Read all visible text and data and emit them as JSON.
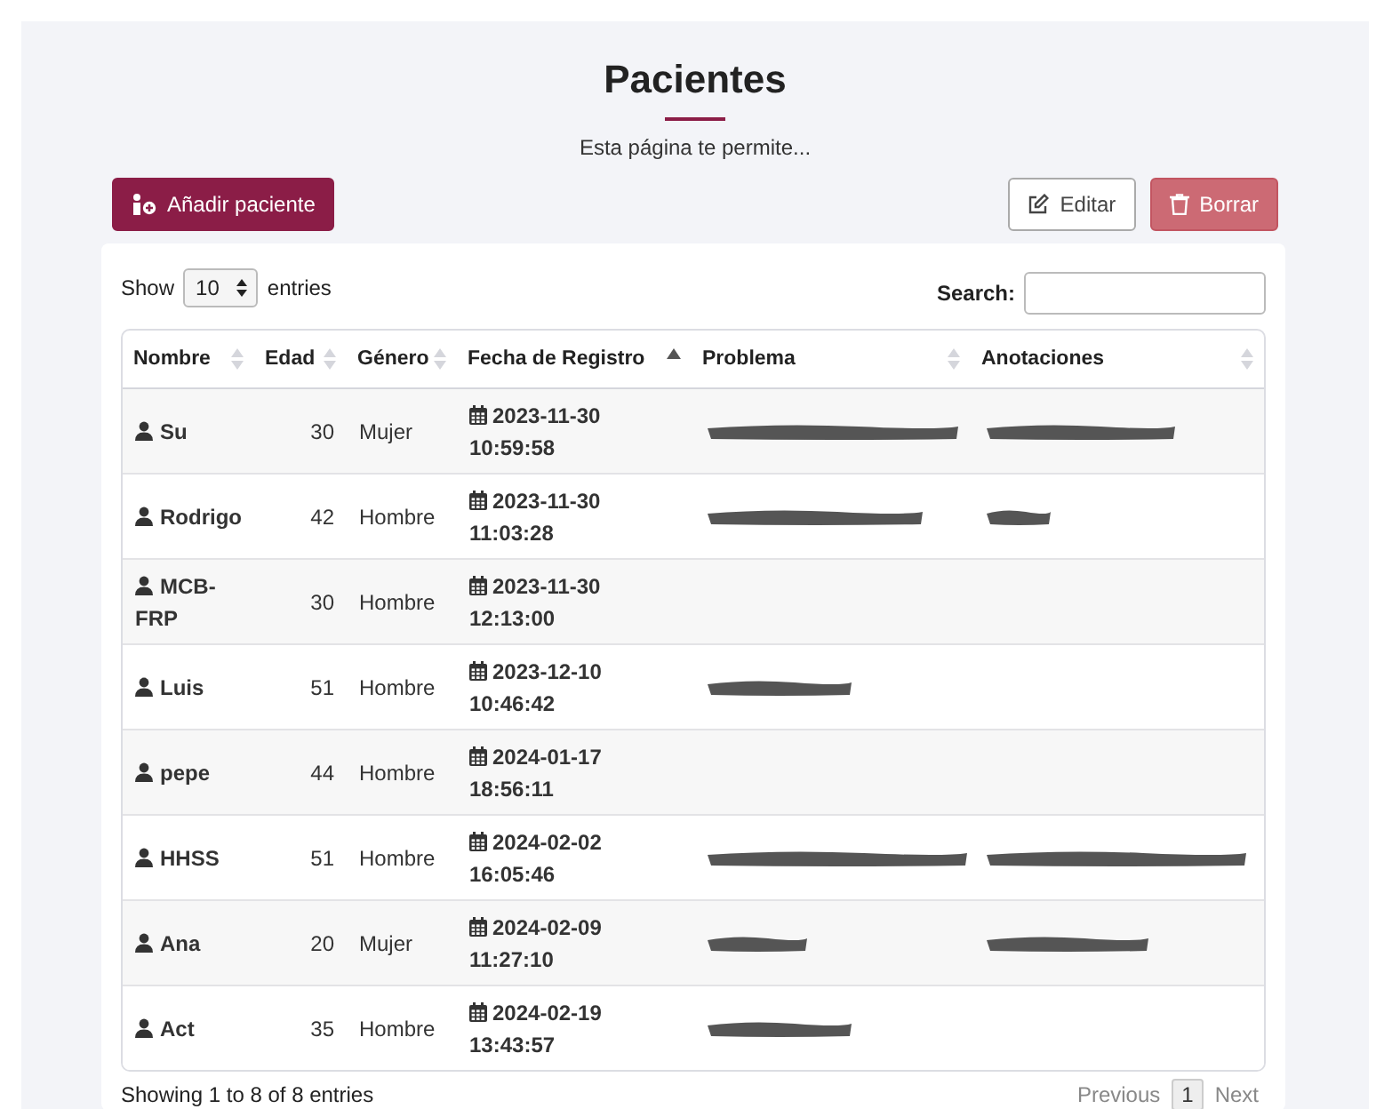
{
  "title": "Pacientes",
  "subtitle": "Esta página te permite...",
  "actions": [
    {
      "kind": "add",
      "label": "Añadir paciente"
    },
    {
      "kind": "edit",
      "label": "Editar"
    },
    {
      "kind": "delete",
      "label": "Borrar"
    }
  ],
  "length_menu": {
    "before": "Show",
    "value": "10",
    "after": "entries"
  },
  "search": {
    "label": "Search:"
  },
  "table": {
    "columns": [
      {
        "label": "Nombre",
        "sorted_ascending": false
      },
      {
        "label": "Edad",
        "sorted_ascending": false
      },
      {
        "label": "Género",
        "sorted_ascending": false
      },
      {
        "label": "Fecha de Registro",
        "sorted_ascending": true
      },
      {
        "label": "Problema",
        "sorted_ascending": false
      },
      {
        "label": "Anotaciones",
        "sorted_ascending": false
      }
    ],
    "rows": [
      {
        "name": "Su",
        "age": "30",
        "gender": "Mujer",
        "date": "2023-11-30",
        "time": "10:59:58",
        "problem_redacted": true,
        "notes_redacted": true
      },
      {
        "name": "Rodrigo",
        "age": "42",
        "gender": "Hombre",
        "date": "2023-11-30",
        "time": "11:03:28",
        "problem_redacted": true,
        "notes_redacted": true
      },
      {
        "name": "MCB-FRP",
        "age": "30",
        "gender": "Hombre",
        "date": "2023-11-30",
        "time": "12:13:00",
        "problem_redacted": false,
        "notes_redacted": false
      },
      {
        "name": "Luis",
        "age": "51",
        "gender": "Hombre",
        "date": "2023-12-10",
        "time": "10:46:42",
        "problem_redacted": true,
        "notes_redacted": false
      },
      {
        "name": "pepe",
        "age": "44",
        "gender": "Hombre",
        "date": "2024-01-17",
        "time": "18:56:11",
        "problem_redacted": false,
        "notes_redacted": false
      },
      {
        "name": "HHSS",
        "age": "51",
        "gender": "Hombre",
        "date": "2024-02-02",
        "time": "16:05:46",
        "problem_redacted": true,
        "notes_redacted": true
      },
      {
        "name": "Ana",
        "age": "20",
        "gender": "Mujer",
        "date": "2024-02-09",
        "time": "11:27:10",
        "problem_redacted": true,
        "notes_redacted": true
      },
      {
        "name": "Act",
        "age": "35",
        "gender": "Hombre",
        "date": "2024-02-19",
        "time": "13:43:57",
        "problem_redacted": true,
        "notes_redacted": false
      }
    ]
  },
  "info": "Showing 1 to 8 of 8 entries",
  "pagination": {
    "previous": {
      "label": "Previous",
      "disabled": true
    },
    "pages": [
      {
        "label": "1",
        "selected": true
      }
    ],
    "next": {
      "label": "Next",
      "disabled": true
    }
  }
}
